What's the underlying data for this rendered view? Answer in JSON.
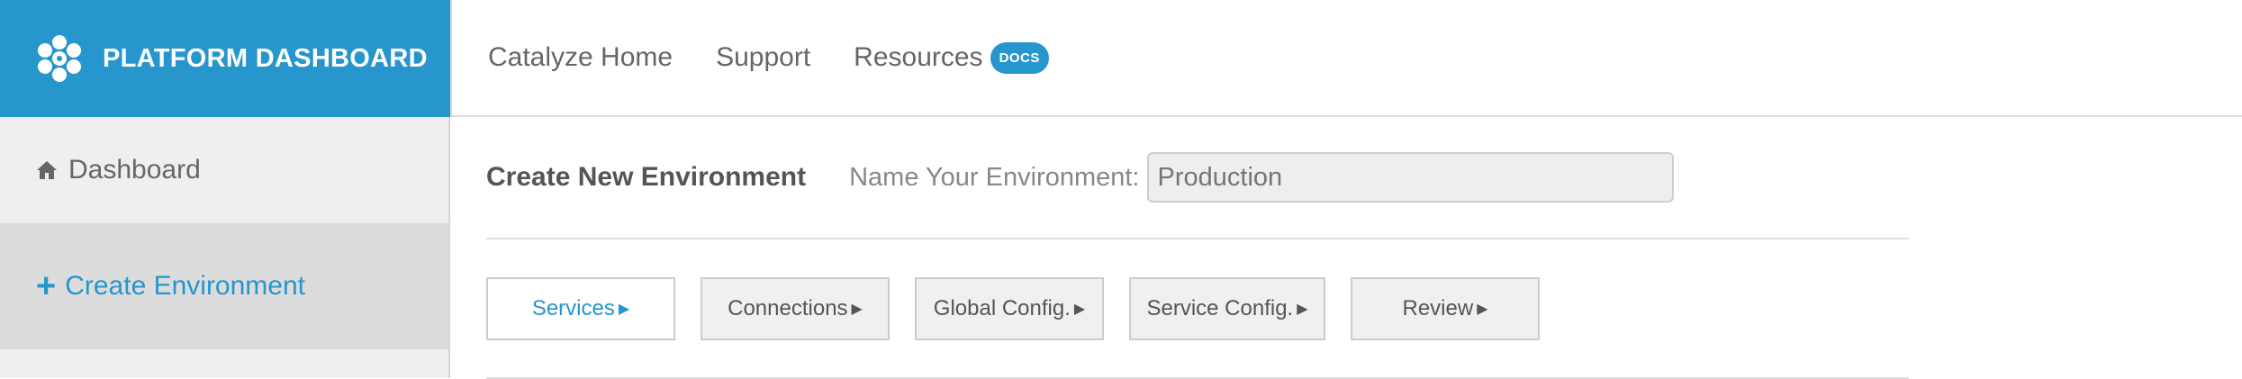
{
  "brand": {
    "title": "PLATFORM DASHBOARD",
    "logo_icon": "hexagon-cluster-icon",
    "color": "#2796cc"
  },
  "topnav": {
    "items": [
      {
        "label": "Catalyze Home"
      },
      {
        "label": "Support"
      },
      {
        "label": "Resources",
        "badge": "DOCS"
      }
    ]
  },
  "sidebar": {
    "items": [
      {
        "label": "Dashboard",
        "icon": "home-icon"
      },
      {
        "label": "Create Environment",
        "icon": "plus-icon",
        "active": true
      }
    ]
  },
  "main": {
    "title": "Create New Environment",
    "name_label": "Name Your Environment:",
    "name_placeholder": "Production",
    "steps": [
      {
        "label": "Services",
        "active": true
      },
      {
        "label": "Connections"
      },
      {
        "label": "Global Config."
      },
      {
        "label": "Service Config."
      },
      {
        "label": "Review"
      }
    ]
  }
}
